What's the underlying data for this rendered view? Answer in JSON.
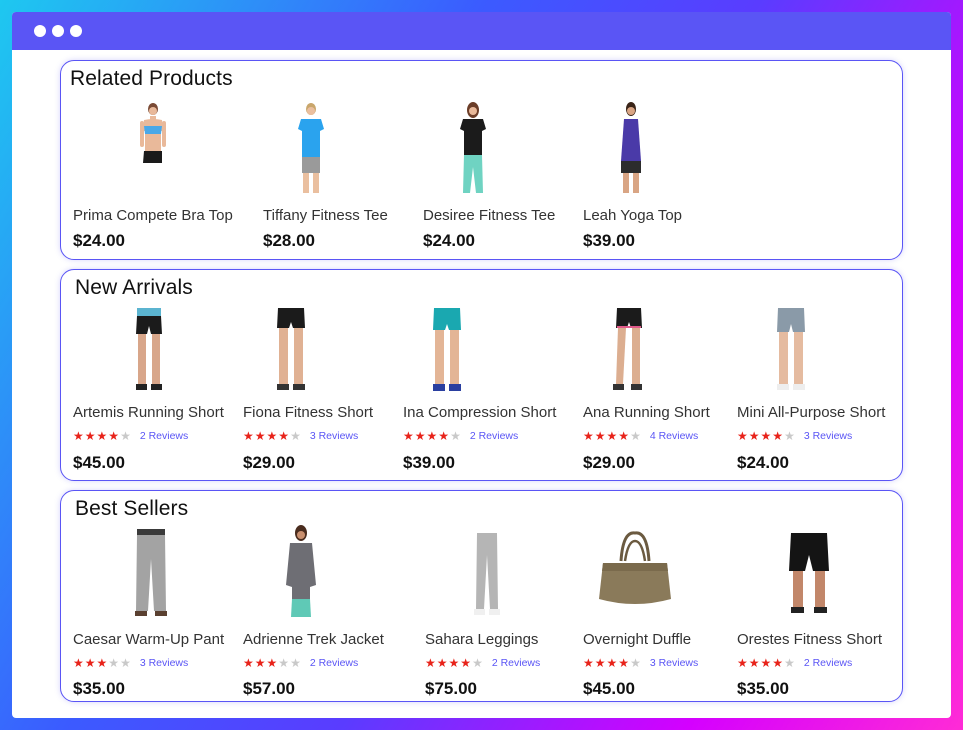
{
  "window": {
    "title_dots": 3,
    "accent": "#5a55f5"
  },
  "related": {
    "title": "Related Products",
    "items": [
      {
        "name": "Prima Compete Bra Top",
        "price": "$24.00",
        "image": "woman-bra-top"
      },
      {
        "name": "Tiffany Fitness Tee",
        "price": "$28.00",
        "image": "woman-blue-tee"
      },
      {
        "name": "Desiree Fitness Tee",
        "price": "$24.00",
        "image": "woman-black-tee"
      },
      {
        "name": "Leah Yoga Top",
        "price": "$39.00",
        "image": "woman-purple-tank"
      }
    ]
  },
  "new_arrivals": {
    "title": "New Arrivals",
    "items": [
      {
        "name": "Artemis Running Short",
        "price": "$45.00",
        "stars": 4,
        "reviews": "2 Reviews",
        "image": "shorts-black-blue"
      },
      {
        "name": "Fiona Fitness Short",
        "price": "$29.00",
        "stars": 4,
        "reviews": "3 Reviews",
        "image": "shorts-black"
      },
      {
        "name": "Ina Compression Short",
        "price": "$39.00",
        "stars": 4,
        "reviews": "2 Reviews",
        "image": "shorts-teal"
      },
      {
        "name": "Ana Running Short",
        "price": "$29.00",
        "stars": 4,
        "reviews": "4 Reviews",
        "image": "shorts-black-pink"
      },
      {
        "name": "Mini All-Purpose Short",
        "price": "$24.00",
        "stars": 4,
        "reviews": "3 Reviews",
        "image": "shorts-grey"
      }
    ]
  },
  "best_sellers": {
    "title": "Best Sellers",
    "items": [
      {
        "name": "Caesar Warm-Up Pant",
        "price": "$35.00",
        "stars": 3,
        "reviews": "3 Reviews",
        "image": "man-grey-pants"
      },
      {
        "name": "Adrienne Trek Jacket",
        "price": "$57.00",
        "stars": 3,
        "reviews": "2 Reviews",
        "image": "woman-grey-jacket"
      },
      {
        "name": "Sahara Leggings",
        "price": "$75.00",
        "stars": 4,
        "reviews": "2 Reviews",
        "image": "grey-leggings"
      },
      {
        "name": "Overnight Duffle",
        "price": "$45.00",
        "stars": 4,
        "reviews": "3 Reviews",
        "image": "brown-duffle-bag"
      },
      {
        "name": "Orestes Fitness Short",
        "price": "$35.00",
        "stars": 4,
        "reviews": "2 Reviews",
        "image": "man-black-shorts"
      }
    ]
  }
}
